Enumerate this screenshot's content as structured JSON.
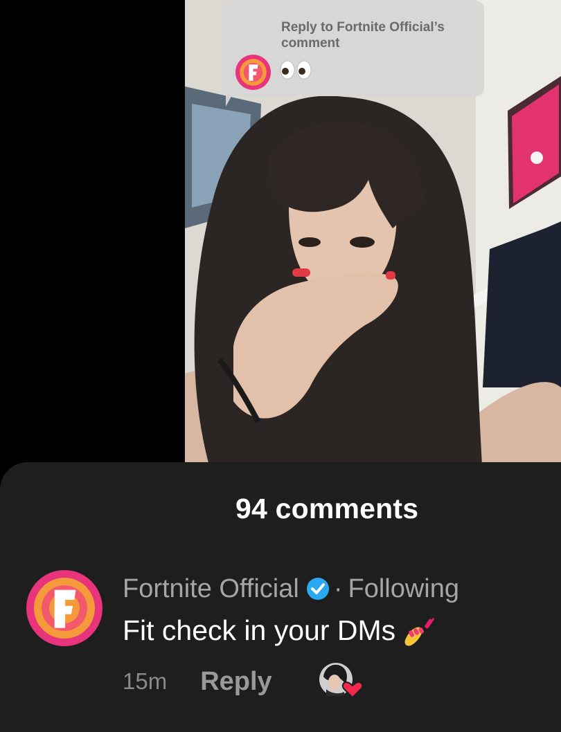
{
  "reply_bubble": {
    "line1": "Reply to Fortnite Official’s",
    "line2": "comment",
    "reply_emoji": "eyes-emoji"
  },
  "comments_panel": {
    "count_label": "94 comments",
    "comment": {
      "author": "Fortnite Official",
      "separator": "·",
      "follow_status": "Following",
      "text": "Fit check in your DMs",
      "text_emoji": "nail-polish-emoji",
      "time": "15m",
      "reply_label": "Reply",
      "creator_liked_icon": "creator-liked-heart-icon"
    }
  },
  "colors": {
    "panel_bg": "#1e1e1e",
    "verified_blue": "#2aa9f2",
    "like_red": "#f2294d",
    "avatar_pink": "#e8347a",
    "avatar_orange": "#f59a3a"
  }
}
